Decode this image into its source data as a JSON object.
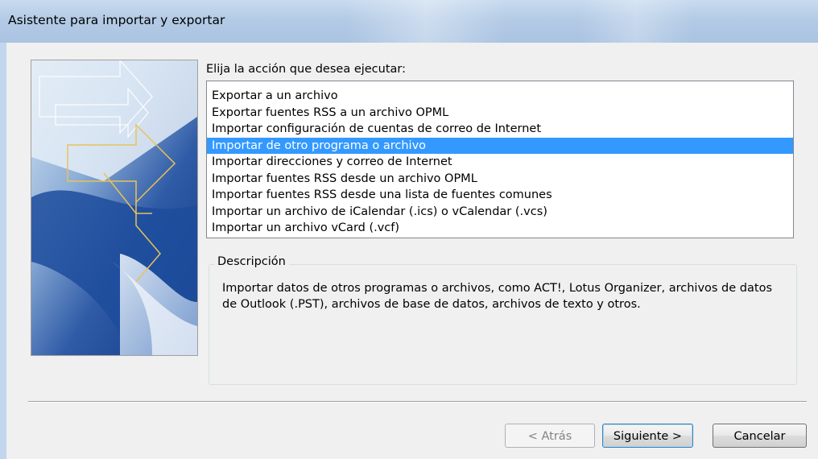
{
  "window": {
    "title": "Asistente para importar y exportar"
  },
  "prompt_label": "Elija la acción que desea ejecutar:",
  "actions": [
    {
      "label": "Exportar a un archivo",
      "selected": false
    },
    {
      "label": "Exportar fuentes RSS a un archivo OPML",
      "selected": false
    },
    {
      "label": "Importar configuración de cuentas de correo de Internet",
      "selected": false
    },
    {
      "label": "Importar de otro programa o archivo",
      "selected": true
    },
    {
      "label": "Importar direcciones y correo de Internet",
      "selected": false
    },
    {
      "label": "Importar fuentes RSS desde un archivo OPML",
      "selected": false
    },
    {
      "label": "Importar fuentes RSS desde una lista de fuentes comunes",
      "selected": false
    },
    {
      "label": "Importar un archivo de iCalendar (.ics) o vCalendar (.vcs)",
      "selected": false
    },
    {
      "label": "Importar un archivo vCard (.vcf)",
      "selected": false
    }
  ],
  "description": {
    "label": "Descripción",
    "text": "Importar datos de otros programas o archivos, como ACT!, Lotus Organizer, archivos de datos de Outlook (.PST), archivos de base de datos, archivos de texto y otros."
  },
  "buttons": {
    "back": "< Atrás",
    "next": "Siguiente >",
    "cancel": "Cancelar"
  },
  "colors": {
    "selection": "#3399ff",
    "titlebar": "#b4cbe6"
  }
}
